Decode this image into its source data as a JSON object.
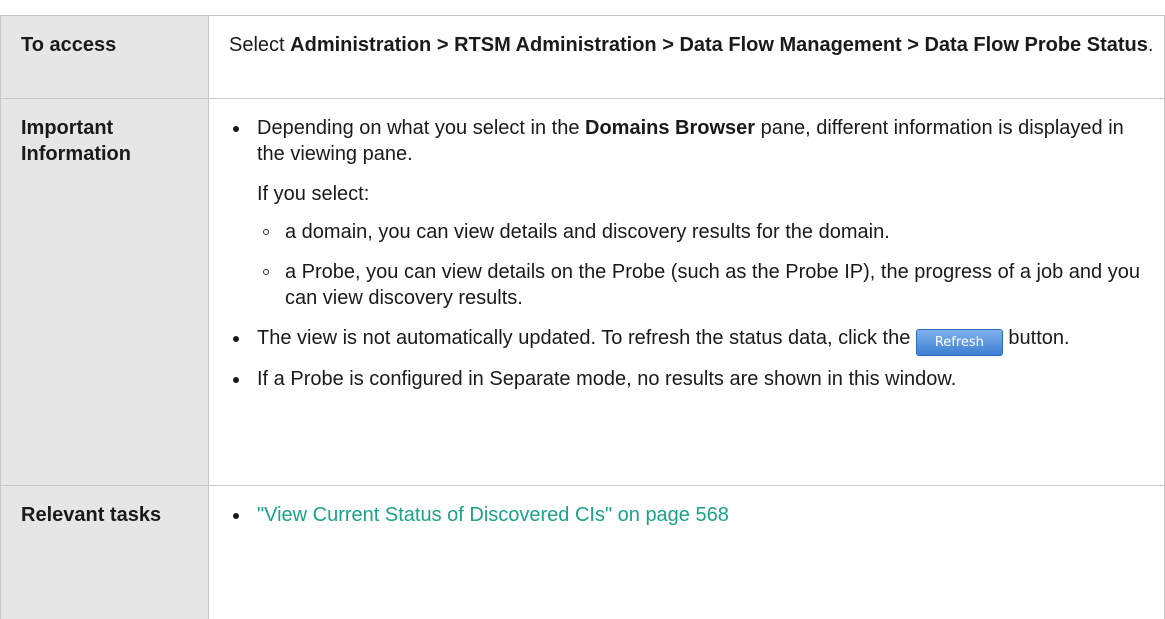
{
  "colors": {
    "label_bg": "#e6e6e6",
    "border": "#c8c8c8",
    "link": "#1aa38a",
    "button_blue": "#3d7fd3"
  },
  "rows": {
    "access": {
      "label": "To access",
      "pre": "Select ",
      "path": "Administration > RTSM Administration > Data Flow Management > Data Flow Probe Status",
      "post": "."
    },
    "important": {
      "label": "Important Information",
      "bullet1_pre": "Depending on what you select in the ",
      "bullet1_bold": "Domains Browser",
      "bullet1_post": " pane, different information is displayed in the viewing pane.",
      "if_select": "If you select:",
      "sub1": "a domain, you can view details and discovery results for the domain.",
      "sub2": "a Probe, you can view details on the Probe (such as the Probe IP), the progress of a job and you can view discovery results.",
      "bullet2_pre": "The view is not automatically updated. To refresh the status data, click the ",
      "refresh_button": "Refresh",
      "bullet2_post": " button.",
      "bullet3": "If a Probe is configured in Separate mode, no results are shown in this window."
    },
    "tasks": {
      "label": "Relevant tasks",
      "link": "\"View Current Status of Discovered CIs\" on page 568"
    }
  }
}
